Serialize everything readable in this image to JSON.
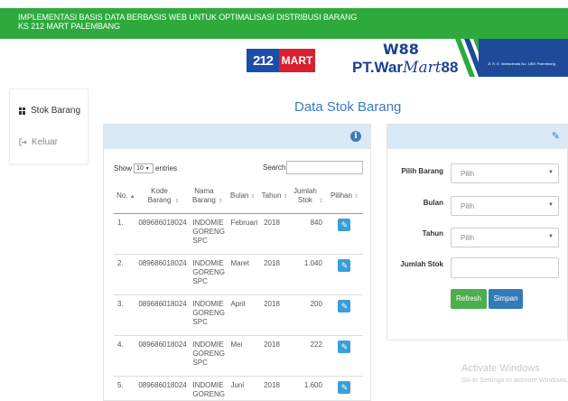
{
  "header": {
    "title_line1": "IMPLEMENTASI BASIS DATA BERBASIS WEB UNTUK OPTIMALISASI DISTRIBUSI BARANG",
    "title_line2": "KS 212 MART PALEMBANG",
    "bar_color": "#2eaa3d"
  },
  "logos": {
    "logo_212_num": "212",
    "logo_212_mart": "MART",
    "warmart_top": "W88",
    "warmart_prefix": "PT.War",
    "warmart_italic": "Mart",
    "warmart_suffix": "88",
    "banner_address": "Jl. R. E. Martadinata No. 1800 Palembang"
  },
  "sidebar": {
    "items": [
      {
        "label": "Stok Barang",
        "icon": "grid-icon"
      },
      {
        "label": "Keluar",
        "icon": "logout-icon"
      }
    ]
  },
  "main": {
    "page_title": "Data Stok Barang"
  },
  "table_controls": {
    "show_label": "Show",
    "show_value": "10",
    "entries_label": "entries",
    "search_label": "Search:",
    "search_value": ""
  },
  "table": {
    "columns": [
      "No.",
      "Kode Barang",
      "Nama Barang",
      "Bulan",
      "Tahun",
      "Jumlah Stok",
      "Pilihan"
    ],
    "rows": [
      {
        "no": "1.",
        "kode": "089686018024",
        "nama": "INDOMIE GORENG SPC",
        "bulan": "Februari",
        "tahun": "2018",
        "jumlah": "840"
      },
      {
        "no": "2.",
        "kode": "089686018024",
        "nama": "INDOMIE GORENG SPC",
        "bulan": "Maret",
        "tahun": "2018",
        "jumlah": "1.040"
      },
      {
        "no": "3.",
        "kode": "089686018024",
        "nama": "INDOMIE GORENG SPC",
        "bulan": "April",
        "tahun": "2018",
        "jumlah": "200"
      },
      {
        "no": "4.",
        "kode": "089686018024",
        "nama": "INDOMIE GORENG SPC",
        "bulan": "Mei",
        "tahun": "2018",
        "jumlah": "222"
      },
      {
        "no": "5.",
        "kode": "089686018024",
        "nama": "INDOMIE GORENG SPC",
        "bulan": "Juni",
        "tahun": "2018",
        "jumlah": "1.600"
      }
    ]
  },
  "form": {
    "pilih_barang_label": "Pilih Barang",
    "pilih_barang_value": "Pilih",
    "bulan_label": "Bulan",
    "bulan_value": "Pilih",
    "tahun_label": "Tahun",
    "tahun_value": "Pilih",
    "jumlah_stok_label": "Jumlah Stok",
    "jumlah_stok_value": "",
    "refresh_label": "Refresh",
    "simpan_label": "Simpan"
  },
  "watermark": {
    "line1": "Activate Windows",
    "line2": "Go to Settings to activate Windows."
  }
}
